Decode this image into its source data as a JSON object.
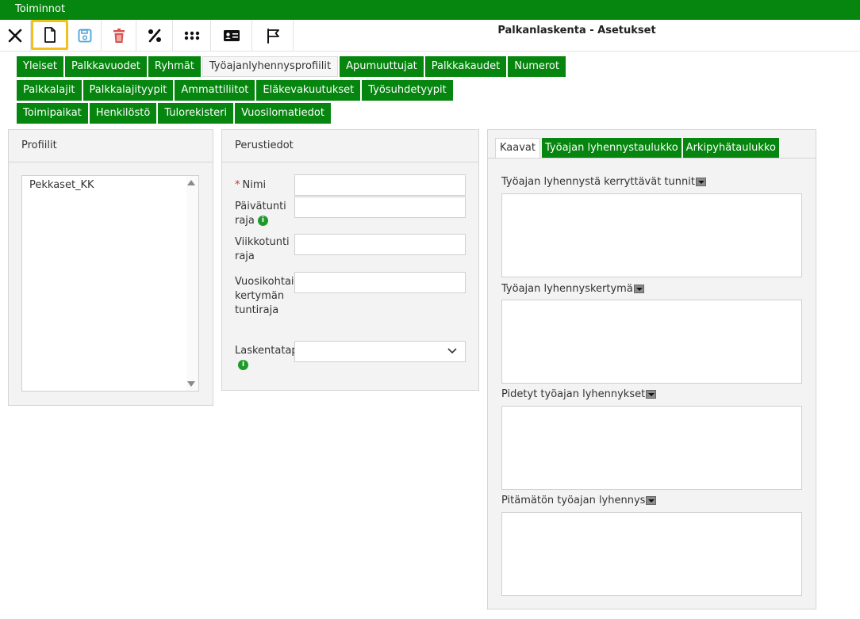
{
  "menubar": {
    "title": "Toiminnot"
  },
  "toolbar": {
    "buttons": [
      {
        "name": "close-button",
        "icon": "close-icon"
      },
      {
        "name": "new-button",
        "icon": "new-document-icon"
      },
      {
        "name": "save-button",
        "icon": "save-icon"
      },
      {
        "name": "delete-button",
        "icon": "trash-icon"
      },
      {
        "name": "percent-button",
        "icon": "percent-icon"
      },
      {
        "name": "grid-button",
        "icon": "grid-icon"
      },
      {
        "name": "card-button",
        "icon": "id-card-icon"
      },
      {
        "name": "flag-button",
        "icon": "flag-icon"
      }
    ]
  },
  "page_title": "Palkanlaskenta - Asetukset",
  "tabs": {
    "row1": [
      "Yleiset",
      "Palkkavuodet",
      "Ryhmät",
      "Työajanlyhennysprofiilit",
      "Apumuuttujat",
      "Palkkakaudet",
      "Numerot"
    ],
    "row2": [
      "Palkkalajit",
      "Palkkalajityypit",
      "Ammattiliitot",
      "Eläkevakuutukset",
      "Työsuhdetyypit"
    ],
    "row3": [
      "Toimipaikat",
      "Henkilöstö",
      "Tulorekisteri",
      "Vuosilomatiedot"
    ],
    "selected": "Työajanlyhennysprofiilit"
  },
  "profiles": {
    "header": "Profiilit",
    "items": [
      "Pekkaset_KK"
    ]
  },
  "basic": {
    "header": "Perustiedot",
    "name_label": "Nimi",
    "required_mark": "*",
    "daily_label": "Päivätunti raja",
    "weekly_label": "Viikkotunti raja",
    "yearly_label": "Vuosikohtainen kertymän tuntiraja",
    "method_label": "Laskentatapa",
    "name_value": "",
    "daily_value": "",
    "weekly_value": "",
    "yearly_value": "",
    "method_value": ""
  },
  "formulas": {
    "tabs": [
      "Kaavat",
      "Työajan lyhennystaulukko",
      "Arkipyhätaulukko"
    ],
    "selected_tab": "Kaavat",
    "fields": [
      {
        "label": "Työajan lyhennystä kerryttävät tunnit",
        "value": ""
      },
      {
        "label": "Työajan lyhennyskertymä",
        "value": ""
      },
      {
        "label": "Pidetyt työajan lyhennykset",
        "value": ""
      },
      {
        "label": "Pitämätön työajan lyhennys",
        "value": ""
      }
    ]
  },
  "colors": {
    "brand_green": "#06850f",
    "highlight": "#f2c21b",
    "save_blue": "#4aa3d8",
    "delete_red": "#d9534f"
  }
}
